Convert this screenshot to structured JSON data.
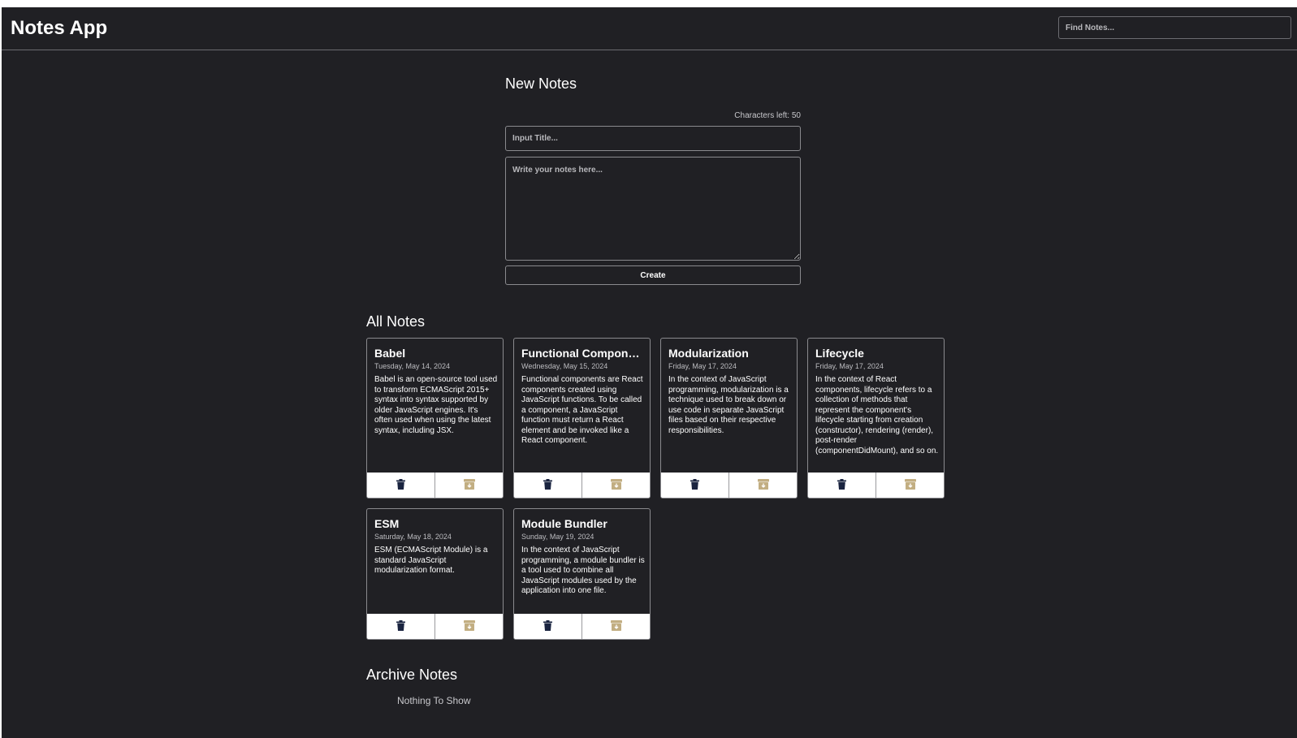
{
  "app": {
    "title": "Notes App"
  },
  "search": {
    "placeholder": "Find Notes..."
  },
  "new_notes": {
    "heading": "New Notes",
    "char_left": "Characters left: 50",
    "title_placeholder": "Input Title...",
    "body_placeholder": "Write your notes here...",
    "create_label": "Create"
  },
  "all_notes": {
    "heading": "All Notes",
    "notes": [
      {
        "title": "Babel",
        "date": "Tuesday, May 14, 2024",
        "body": "Babel is an open-source tool used to transform ECMAScript 2015+ syntax into syntax supported by older JavaScript engines. It's often used when using the latest syntax, including JSX."
      },
      {
        "title": "Functional Components",
        "date": "Wednesday, May 15, 2024",
        "body": "Functional components are React components created using JavaScript functions. To be called a component, a JavaScript function must return a React element and be invoked like a React component."
      },
      {
        "title": "Modularization",
        "date": "Friday, May 17, 2024",
        "body": "In the context of JavaScript programming, modularization is a technique used to break down or use code in separate JavaScript files based on their respective responsibilities."
      },
      {
        "title": "Lifecycle",
        "date": "Friday, May 17, 2024",
        "body": "In the context of React components, lifecycle refers to a collection of methods that represent the component's lifecycle starting from creation (constructor), rendering (render), post-render (componentDidMount), and so on."
      },
      {
        "title": "ESM",
        "date": "Saturday, May 18, 2024",
        "body": "ESM (ECMAScript Module) is a standard JavaScript modularization format."
      },
      {
        "title": "Module Bundler",
        "date": "Sunday, May 19, 2024",
        "body": "In the context of JavaScript programming, a module bundler is a tool used to combine all JavaScript modules used by the application into one file."
      }
    ],
    "actions": {
      "delete_icon": "trash-icon",
      "archive_icon": "archive-box-icon"
    }
  },
  "archive_notes": {
    "heading": "Archive Notes",
    "empty_text": "Nothing To Show"
  },
  "colors": {
    "background": "#202024",
    "trash": "#1a2440",
    "archive": "#c2ae82"
  }
}
